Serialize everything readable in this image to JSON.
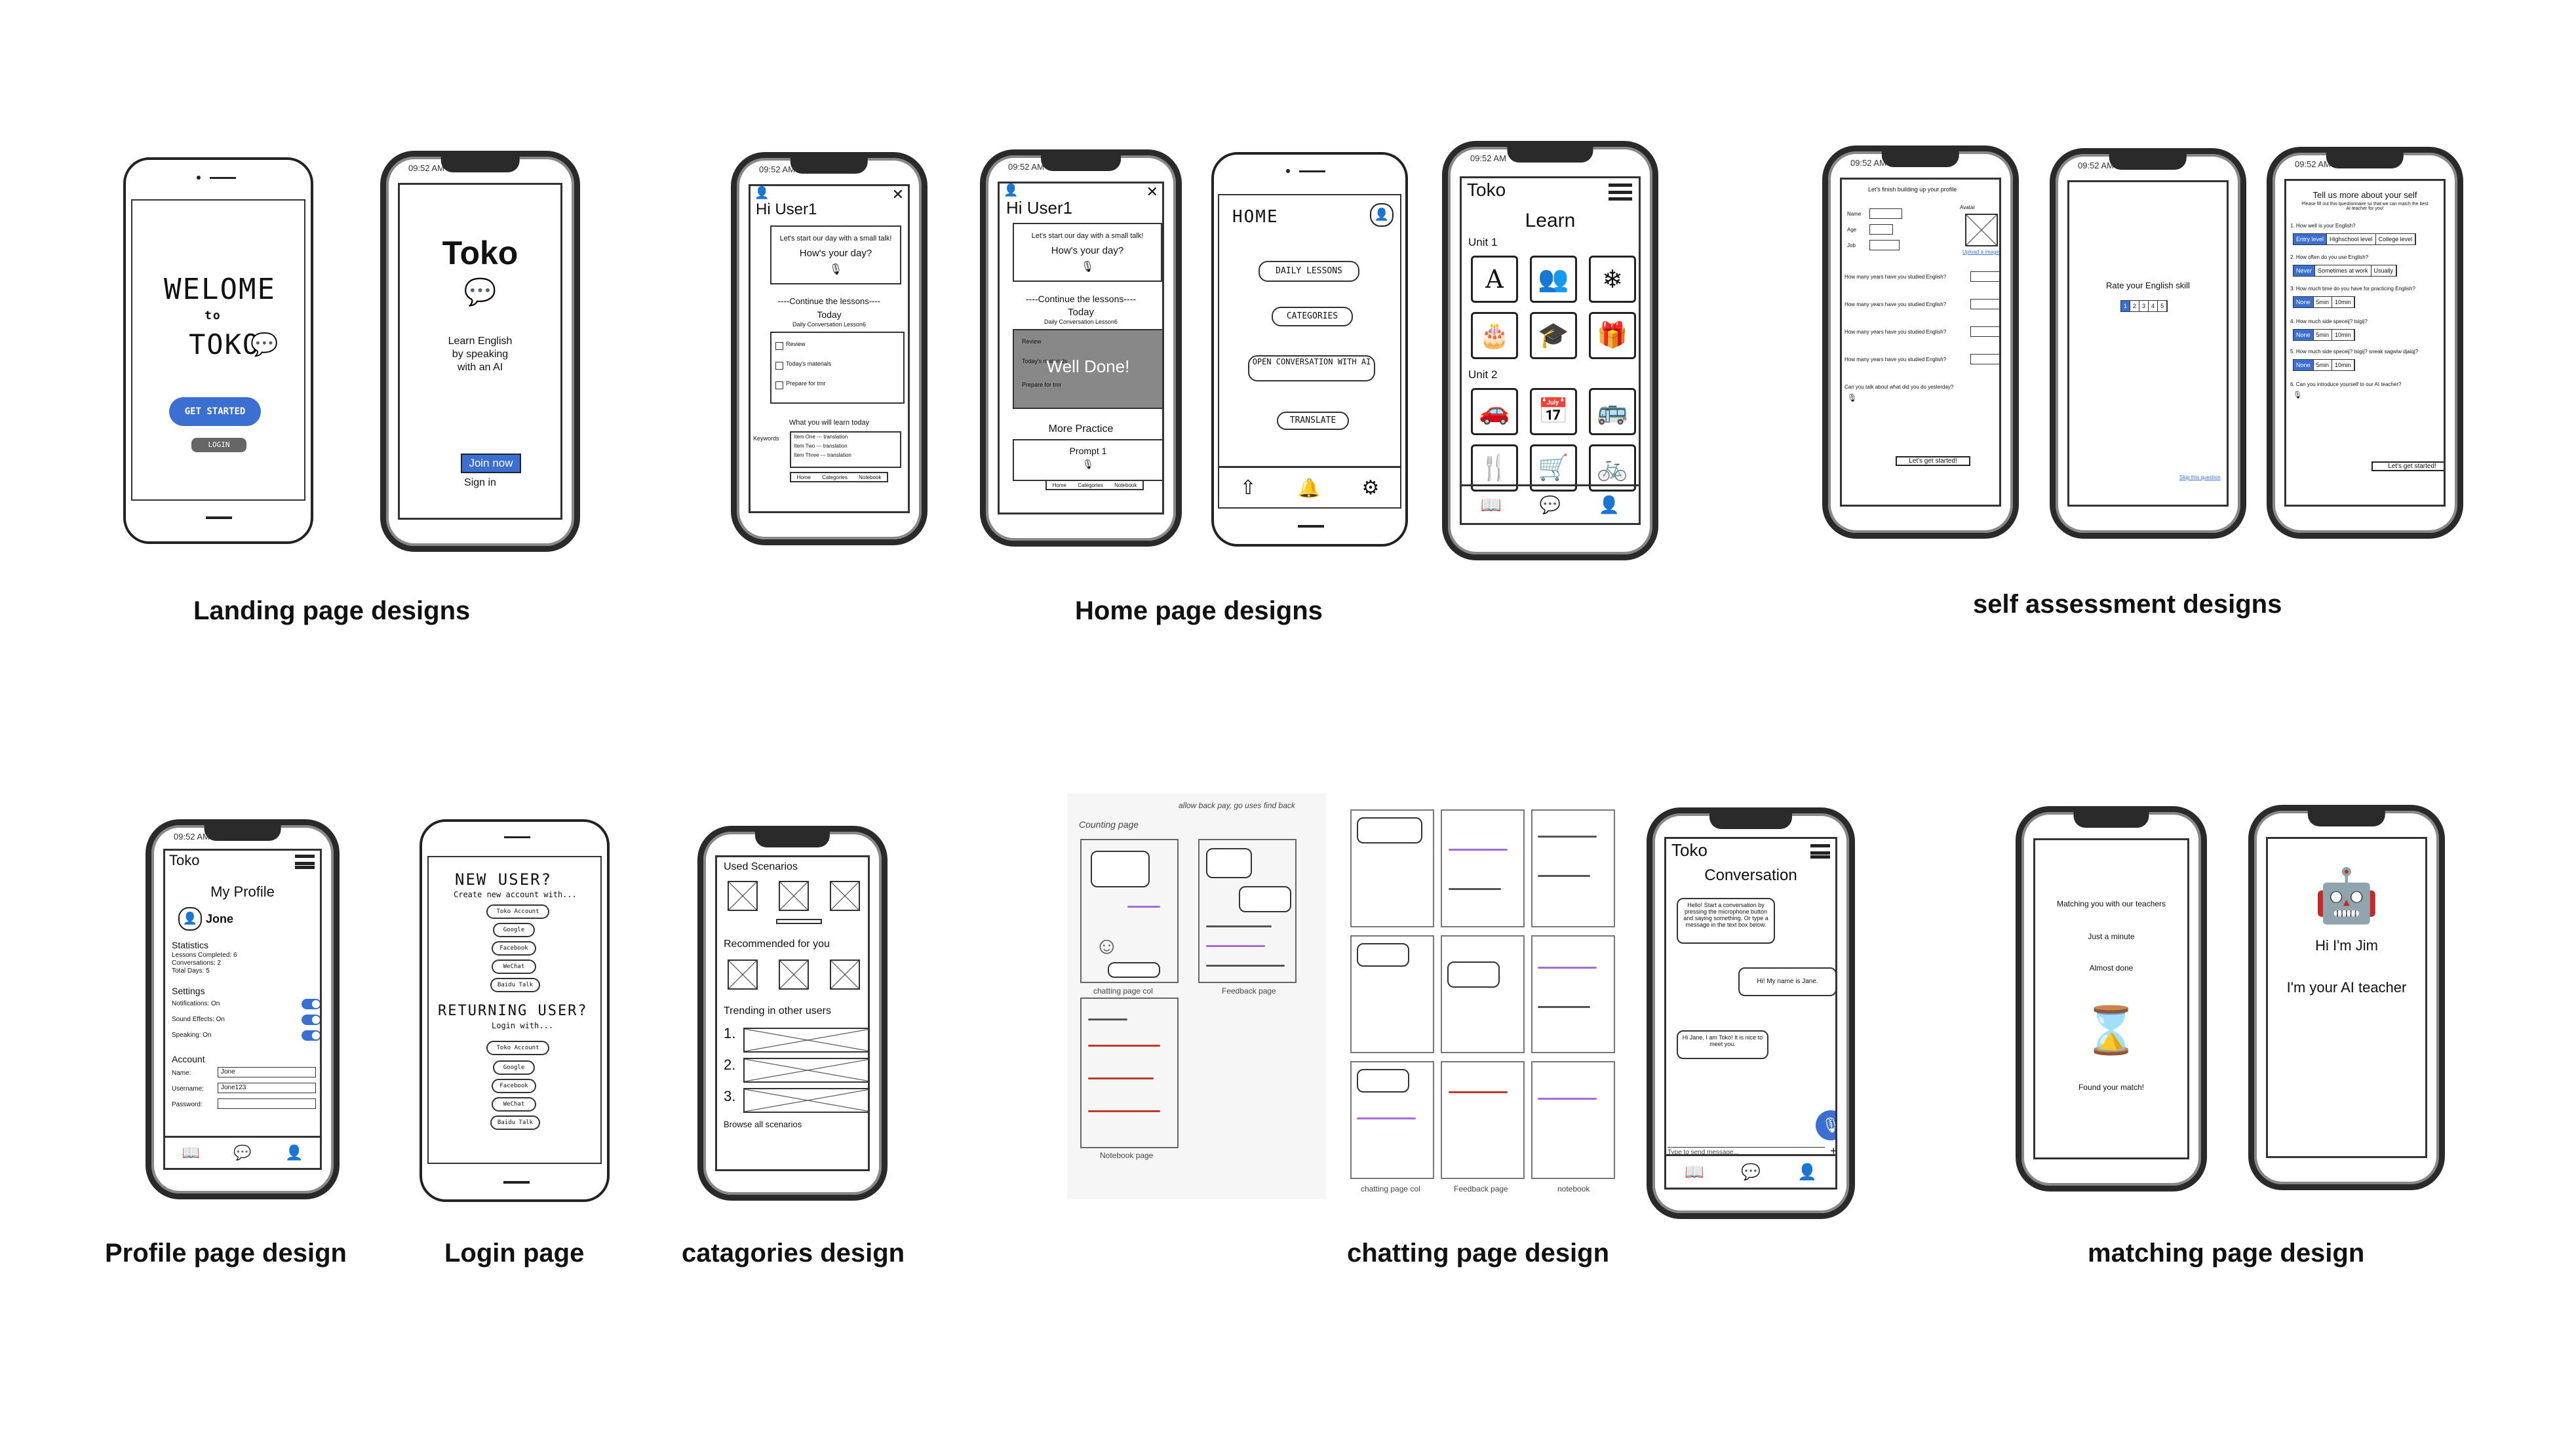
{
  "section_labels": {
    "landing": "Landing page designs",
    "home": "Home page designs",
    "self_assessment": "self assessment designs",
    "profile": "Profile page design",
    "login": "Login page",
    "categories": "catagories design",
    "chatting": "chatting page design",
    "matching": "matching page design"
  },
  "landing": {
    "welcome_line1": "WELOME",
    "welcome_line2": "to",
    "welcome_line3": "TOKO",
    "get_started": "GET STARTED",
    "login": "LOGIN",
    "app_title": "Toko",
    "tagline_1": "Learn English",
    "tagline_2": "by speaking",
    "tagline_3": "with an AI",
    "join_now": "Join now",
    "sign_in": "Sign in"
  },
  "home": {
    "greeting": "Hi User1",
    "smalltalk": "Let's start our day with a small talk!",
    "hows_day": "How's your day?",
    "continue": "----Continue the lessons----",
    "today": "Today",
    "lesson": "Daily Conversation Lesson6",
    "tasks": [
      "Review",
      "Today's materials",
      "Prepare for tmr"
    ],
    "learn_today": "What you will learn today",
    "keywords": "Keywords",
    "kw_items": [
      "Item One --- translation",
      "Item Two --- translation",
      "Item Three --- translation"
    ],
    "tabs": [
      "Home",
      "Categories",
      "Notebook"
    ],
    "well_done": "Well Done!",
    "more_practice": "More Practice",
    "prompt": "Prompt 1",
    "sketch_home": "HOME",
    "sketch_menu": [
      "DAILY LESSONS",
      "CATEGORIES",
      "OPEN CONVERSATION WITH AI",
      "TRANSLATE"
    ],
    "toko": "Toko",
    "learn": "Learn",
    "unit1": "Unit 1",
    "unit2": "Unit 2"
  },
  "self_assessment": {
    "build_profile": "Let's finish building up your profile",
    "name": "Name",
    "age": "Age",
    "job": "Job",
    "avatar": "Avatar",
    "upload": "Upload a image",
    "years_q": "How many years have you studied English?",
    "talk_q": "Can you talk about what did you do yesterday?",
    "lets_get_started": "Let's get started!",
    "rate": "Rate your English skill",
    "skip": "Skip this question",
    "tell_us": "Tell us more about your self",
    "tell_sub": "Please fill out this questionnaire so that we can match the best AI teacher for you!",
    "q1": "1. How well is your English?",
    "q2": "2. How often do you use English?",
    "q3": "3. How much time do you have for practicing English?",
    "q4": "4. How much side speceij? tsigij?",
    "q5": "5. How much side speceij? tsigij? sneak sagwiw djaiqj?",
    "q6": "6. Can you introduce yourself to our AI teacher?"
  },
  "profile": {
    "toko": "Toko",
    "title": "My Profile",
    "user": "Jone",
    "statistics": "Statistics",
    "stats": [
      "Lessons Completed: 6",
      "Conversations: 2",
      "Total Days: 5"
    ],
    "settings": "Settings",
    "setting_items": [
      "Notifications: On",
      "Sound Effects: On",
      "Speaking: On"
    ],
    "account": "Account",
    "acc_labels": [
      "Name:",
      "Username:",
      "Password:"
    ],
    "acc_values": [
      "Jone",
      "Jone123",
      ""
    ]
  },
  "login": {
    "new_user": "NEW USER?",
    "create": "Create new account with...",
    "new_opts": [
      "Toko Account",
      "Google",
      "Facebook",
      "WeChat",
      "Baidu Talk"
    ],
    "returning": "RETURNING USER?",
    "login_with": "Login with...",
    "ret_opts": [
      "Toko Account",
      "Google",
      "Facebook",
      "WeChat",
      "Baidu Talk"
    ]
  },
  "categories": {
    "used": "Used Scenarios",
    "recommended": "Recommended for you",
    "trending": "Trending in other users",
    "nums": [
      "1.",
      "2.",
      "3."
    ],
    "browse": "Browse all scenarios"
  },
  "chatting": {
    "sketch_top": "Counting page",
    "sketch_note": "allow back pay, go uses find back",
    "cap1": "chatting page col",
    "cap2": "Feedback page",
    "cap3": "Notebook page",
    "cap4": "chatting page col",
    "cap5": "Feedback page",
    "cap6": "notebook",
    "toko": "Toko",
    "conversation": "Conversation",
    "msg1": "Hello! Start a conversation by pressing the microphone button and saying something. Or type a message in the text box below.",
    "msg2": "Hi! My name is Jane.",
    "msg3": "Hi Jane, I am Toko! It is nice to meet you.",
    "input_placeholder": "Type to send message..."
  },
  "matching": {
    "matching": "Matching you with our teachers",
    "just_minute": "Just a minute",
    "almost": "Almost done",
    "found": "Found your match!",
    "hi_jim": "Hi I'm Jim",
    "ai_teacher": "I'm your AI teacher"
  },
  "status_time": "09:52 AM",
  "colors": {
    "accent": "#3b6fd1",
    "ink": "#222222",
    "done_overlay": "#888888"
  }
}
